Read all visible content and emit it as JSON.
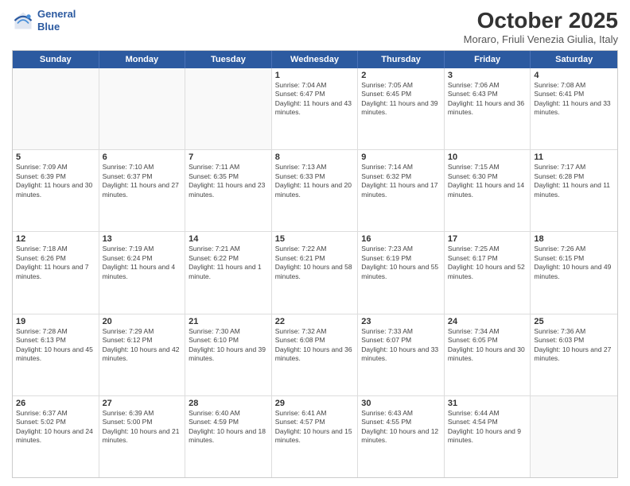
{
  "header": {
    "logo_line1": "General",
    "logo_line2": "Blue",
    "month_title": "October 2025",
    "subtitle": "Moraro, Friuli Venezia Giulia, Italy"
  },
  "days_of_week": [
    "Sunday",
    "Monday",
    "Tuesday",
    "Wednesday",
    "Thursday",
    "Friday",
    "Saturday"
  ],
  "weeks": [
    [
      {
        "day": "",
        "sunrise": "",
        "sunset": "",
        "daylight": ""
      },
      {
        "day": "",
        "sunrise": "",
        "sunset": "",
        "daylight": ""
      },
      {
        "day": "",
        "sunrise": "",
        "sunset": "",
        "daylight": ""
      },
      {
        "day": "1",
        "sunrise": "Sunrise: 7:04 AM",
        "sunset": "Sunset: 6:47 PM",
        "daylight": "Daylight: 11 hours and 43 minutes."
      },
      {
        "day": "2",
        "sunrise": "Sunrise: 7:05 AM",
        "sunset": "Sunset: 6:45 PM",
        "daylight": "Daylight: 11 hours and 39 minutes."
      },
      {
        "day": "3",
        "sunrise": "Sunrise: 7:06 AM",
        "sunset": "Sunset: 6:43 PM",
        "daylight": "Daylight: 11 hours and 36 minutes."
      },
      {
        "day": "4",
        "sunrise": "Sunrise: 7:08 AM",
        "sunset": "Sunset: 6:41 PM",
        "daylight": "Daylight: 11 hours and 33 minutes."
      }
    ],
    [
      {
        "day": "5",
        "sunrise": "Sunrise: 7:09 AM",
        "sunset": "Sunset: 6:39 PM",
        "daylight": "Daylight: 11 hours and 30 minutes."
      },
      {
        "day": "6",
        "sunrise": "Sunrise: 7:10 AM",
        "sunset": "Sunset: 6:37 PM",
        "daylight": "Daylight: 11 hours and 27 minutes."
      },
      {
        "day": "7",
        "sunrise": "Sunrise: 7:11 AM",
        "sunset": "Sunset: 6:35 PM",
        "daylight": "Daylight: 11 hours and 23 minutes."
      },
      {
        "day": "8",
        "sunrise": "Sunrise: 7:13 AM",
        "sunset": "Sunset: 6:33 PM",
        "daylight": "Daylight: 11 hours and 20 minutes."
      },
      {
        "day": "9",
        "sunrise": "Sunrise: 7:14 AM",
        "sunset": "Sunset: 6:32 PM",
        "daylight": "Daylight: 11 hours and 17 minutes."
      },
      {
        "day": "10",
        "sunrise": "Sunrise: 7:15 AM",
        "sunset": "Sunset: 6:30 PM",
        "daylight": "Daylight: 11 hours and 14 minutes."
      },
      {
        "day": "11",
        "sunrise": "Sunrise: 7:17 AM",
        "sunset": "Sunset: 6:28 PM",
        "daylight": "Daylight: 11 hours and 11 minutes."
      }
    ],
    [
      {
        "day": "12",
        "sunrise": "Sunrise: 7:18 AM",
        "sunset": "Sunset: 6:26 PM",
        "daylight": "Daylight: 11 hours and 7 minutes."
      },
      {
        "day": "13",
        "sunrise": "Sunrise: 7:19 AM",
        "sunset": "Sunset: 6:24 PM",
        "daylight": "Daylight: 11 hours and 4 minutes."
      },
      {
        "day": "14",
        "sunrise": "Sunrise: 7:21 AM",
        "sunset": "Sunset: 6:22 PM",
        "daylight": "Daylight: 11 hours and 1 minute."
      },
      {
        "day": "15",
        "sunrise": "Sunrise: 7:22 AM",
        "sunset": "Sunset: 6:21 PM",
        "daylight": "Daylight: 10 hours and 58 minutes."
      },
      {
        "day": "16",
        "sunrise": "Sunrise: 7:23 AM",
        "sunset": "Sunset: 6:19 PM",
        "daylight": "Daylight: 10 hours and 55 minutes."
      },
      {
        "day": "17",
        "sunrise": "Sunrise: 7:25 AM",
        "sunset": "Sunset: 6:17 PM",
        "daylight": "Daylight: 10 hours and 52 minutes."
      },
      {
        "day": "18",
        "sunrise": "Sunrise: 7:26 AM",
        "sunset": "Sunset: 6:15 PM",
        "daylight": "Daylight: 10 hours and 49 minutes."
      }
    ],
    [
      {
        "day": "19",
        "sunrise": "Sunrise: 7:28 AM",
        "sunset": "Sunset: 6:13 PM",
        "daylight": "Daylight: 10 hours and 45 minutes."
      },
      {
        "day": "20",
        "sunrise": "Sunrise: 7:29 AM",
        "sunset": "Sunset: 6:12 PM",
        "daylight": "Daylight: 10 hours and 42 minutes."
      },
      {
        "day": "21",
        "sunrise": "Sunrise: 7:30 AM",
        "sunset": "Sunset: 6:10 PM",
        "daylight": "Daylight: 10 hours and 39 minutes."
      },
      {
        "day": "22",
        "sunrise": "Sunrise: 7:32 AM",
        "sunset": "Sunset: 6:08 PM",
        "daylight": "Daylight: 10 hours and 36 minutes."
      },
      {
        "day": "23",
        "sunrise": "Sunrise: 7:33 AM",
        "sunset": "Sunset: 6:07 PM",
        "daylight": "Daylight: 10 hours and 33 minutes."
      },
      {
        "day": "24",
        "sunrise": "Sunrise: 7:34 AM",
        "sunset": "Sunset: 6:05 PM",
        "daylight": "Daylight: 10 hours and 30 minutes."
      },
      {
        "day": "25",
        "sunrise": "Sunrise: 7:36 AM",
        "sunset": "Sunset: 6:03 PM",
        "daylight": "Daylight: 10 hours and 27 minutes."
      }
    ],
    [
      {
        "day": "26",
        "sunrise": "Sunrise: 6:37 AM",
        "sunset": "Sunset: 5:02 PM",
        "daylight": "Daylight: 10 hours and 24 minutes."
      },
      {
        "day": "27",
        "sunrise": "Sunrise: 6:39 AM",
        "sunset": "Sunset: 5:00 PM",
        "daylight": "Daylight: 10 hours and 21 minutes."
      },
      {
        "day": "28",
        "sunrise": "Sunrise: 6:40 AM",
        "sunset": "Sunset: 4:59 PM",
        "daylight": "Daylight: 10 hours and 18 minutes."
      },
      {
        "day": "29",
        "sunrise": "Sunrise: 6:41 AM",
        "sunset": "Sunset: 4:57 PM",
        "daylight": "Daylight: 10 hours and 15 minutes."
      },
      {
        "day": "30",
        "sunrise": "Sunrise: 6:43 AM",
        "sunset": "Sunset: 4:55 PM",
        "daylight": "Daylight: 10 hours and 12 minutes."
      },
      {
        "day": "31",
        "sunrise": "Sunrise: 6:44 AM",
        "sunset": "Sunset: 4:54 PM",
        "daylight": "Daylight: 10 hours and 9 minutes."
      },
      {
        "day": "",
        "sunrise": "",
        "sunset": "",
        "daylight": ""
      }
    ]
  ]
}
